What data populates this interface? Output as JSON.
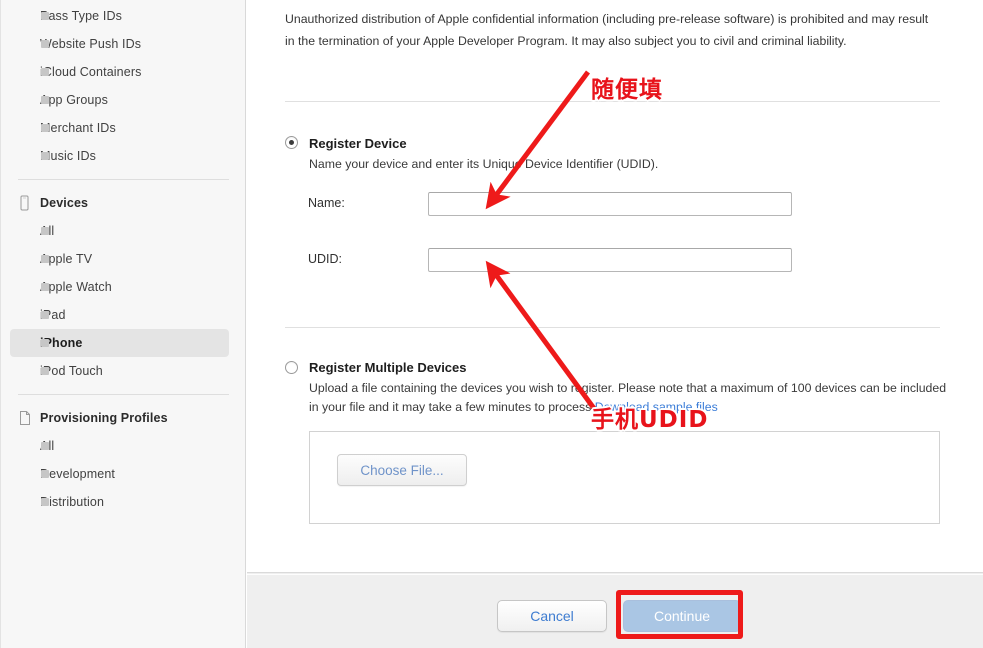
{
  "sidebar": {
    "items": [
      {
        "label": "Pass Type IDs",
        "type": "child",
        "selected": false
      },
      {
        "label": "Website Push IDs",
        "type": "child",
        "selected": false
      },
      {
        "label": "iCloud Containers",
        "type": "child",
        "selected": false
      },
      {
        "label": "App Groups",
        "type": "child",
        "selected": false
      },
      {
        "label": "Merchant IDs",
        "type": "child",
        "selected": false
      },
      {
        "label": "Music IDs",
        "type": "child",
        "selected": false
      },
      {
        "label": "Devices",
        "type": "group",
        "icon": "device-icon",
        "selected": false
      },
      {
        "label": "All",
        "type": "child",
        "selected": false
      },
      {
        "label": "Apple TV",
        "type": "child",
        "selected": false
      },
      {
        "label": "Apple Watch",
        "type": "child",
        "selected": false
      },
      {
        "label": "iPad",
        "type": "child",
        "selected": false
      },
      {
        "label": "iPhone",
        "type": "child",
        "selected": true
      },
      {
        "label": "iPod Touch",
        "type": "child",
        "selected": false
      },
      {
        "label": "Provisioning Profiles",
        "type": "group",
        "icon": "document-icon",
        "selected": false
      },
      {
        "label": "All",
        "type": "child",
        "selected": false
      },
      {
        "label": "Development",
        "type": "child",
        "selected": false
      },
      {
        "label": "Distribution",
        "type": "child",
        "selected": false
      }
    ]
  },
  "main": {
    "disclaimer": "Unauthorized distribution of Apple confidential information (including pre-release software) is prohibited and may result in the termination of your Apple Developer Program. It may also subject you to civil and criminal liability.",
    "register_device": {
      "title": "Register Device",
      "description": "Name your device and enter its Unique Device Identifier (UDID).",
      "selected": true,
      "name_label": "Name:",
      "name_value": "",
      "name_placeholder": "",
      "udid_label": "UDID:",
      "udid_value": "",
      "udid_placeholder": ""
    },
    "register_multiple": {
      "title": "Register Multiple Devices",
      "selected": false,
      "description_part1": "Upload a file containing the devices you wish to register. Please note that a maximum of 100 devices can be included in your file and it may take a few minutes to process.",
      "download_link": "Download sample files",
      "choose_file_label": "Choose File..."
    }
  },
  "footer": {
    "cancel_label": "Cancel",
    "continue_label": "Continue",
    "continue_disabled": true
  },
  "annotations": {
    "note_1": "随便填",
    "note_2": "手机UDID",
    "color": "#ee1a1a"
  }
}
